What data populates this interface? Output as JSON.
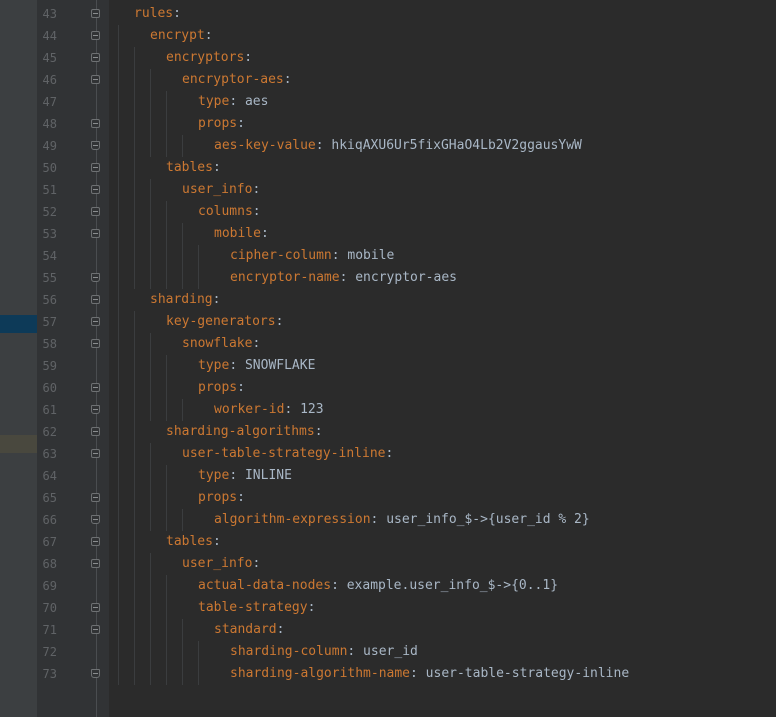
{
  "colors": {
    "background": "#2b2b2b",
    "gutter": "#313335",
    "line_number": "#606366",
    "key": "#cc7832",
    "value": "#a9b7c6",
    "marker_blue": "#0d3a58",
    "marker_olive": "#49483e"
  },
  "lines": [
    {
      "num": "43",
      "indent": 0,
      "key": "rules",
      "value": ""
    },
    {
      "num": "44",
      "indent": 1,
      "key": "encrypt",
      "value": ""
    },
    {
      "num": "45",
      "indent": 2,
      "key": "encryptors",
      "value": ""
    },
    {
      "num": "46",
      "indent": 3,
      "key": "encryptor-aes",
      "value": ""
    },
    {
      "num": "47",
      "indent": 4,
      "key": "type",
      "value": "aes"
    },
    {
      "num": "48",
      "indent": 4,
      "key": "props",
      "value": ""
    },
    {
      "num": "49",
      "indent": 5,
      "key": "aes-key-value",
      "value": "hkiqAXU6Ur5fixGHaO4Lb2V2ggausYwW"
    },
    {
      "num": "50",
      "indent": 2,
      "key": "tables",
      "value": ""
    },
    {
      "num": "51",
      "indent": 3,
      "key": "user_info",
      "value": ""
    },
    {
      "num": "52",
      "indent": 4,
      "key": "columns",
      "value": ""
    },
    {
      "num": "53",
      "indent": 5,
      "key": "mobile",
      "value": ""
    },
    {
      "num": "54",
      "indent": 6,
      "key": "cipher-column",
      "value": "mobile"
    },
    {
      "num": "55",
      "indent": 6,
      "key": "encryptor-name",
      "value": "encryptor-aes"
    },
    {
      "num": "56",
      "indent": 1,
      "key": "sharding",
      "value": ""
    },
    {
      "num": "57",
      "indent": 2,
      "key": "key-generators",
      "value": ""
    },
    {
      "num": "58",
      "indent": 3,
      "key": "snowflake",
      "value": ""
    },
    {
      "num": "59",
      "indent": 4,
      "key": "type",
      "value": "SNOWFLAKE"
    },
    {
      "num": "60",
      "indent": 4,
      "key": "props",
      "value": ""
    },
    {
      "num": "61",
      "indent": 5,
      "key": "worker-id",
      "value": "123"
    },
    {
      "num": "62",
      "indent": 2,
      "key": "sharding-algorithms",
      "value": ""
    },
    {
      "num": "63",
      "indent": 3,
      "key": "user-table-strategy-inline",
      "value": ""
    },
    {
      "num": "64",
      "indent": 4,
      "key": "type",
      "value": "INLINE"
    },
    {
      "num": "65",
      "indent": 4,
      "key": "props",
      "value": ""
    },
    {
      "num": "66",
      "indent": 5,
      "key": "algorithm-expression",
      "value": "user_info_$->{user_id % 2}"
    },
    {
      "num": "67",
      "indent": 2,
      "key": "tables",
      "value": ""
    },
    {
      "num": "68",
      "indent": 3,
      "key": "user_info",
      "value": ""
    },
    {
      "num": "69",
      "indent": 4,
      "key": "actual-data-nodes",
      "value": "example.user_info_$->{0..1}"
    },
    {
      "num": "70",
      "indent": 4,
      "key": "table-strategy",
      "value": ""
    },
    {
      "num": "71",
      "indent": 5,
      "key": "standard",
      "value": ""
    },
    {
      "num": "72",
      "indent": 6,
      "key": "sharding-column",
      "value": "user_id"
    },
    {
      "num": "73",
      "indent": 6,
      "key": "sharding-algorithm-name",
      "value": "user-table-strategy-inline"
    }
  ]
}
